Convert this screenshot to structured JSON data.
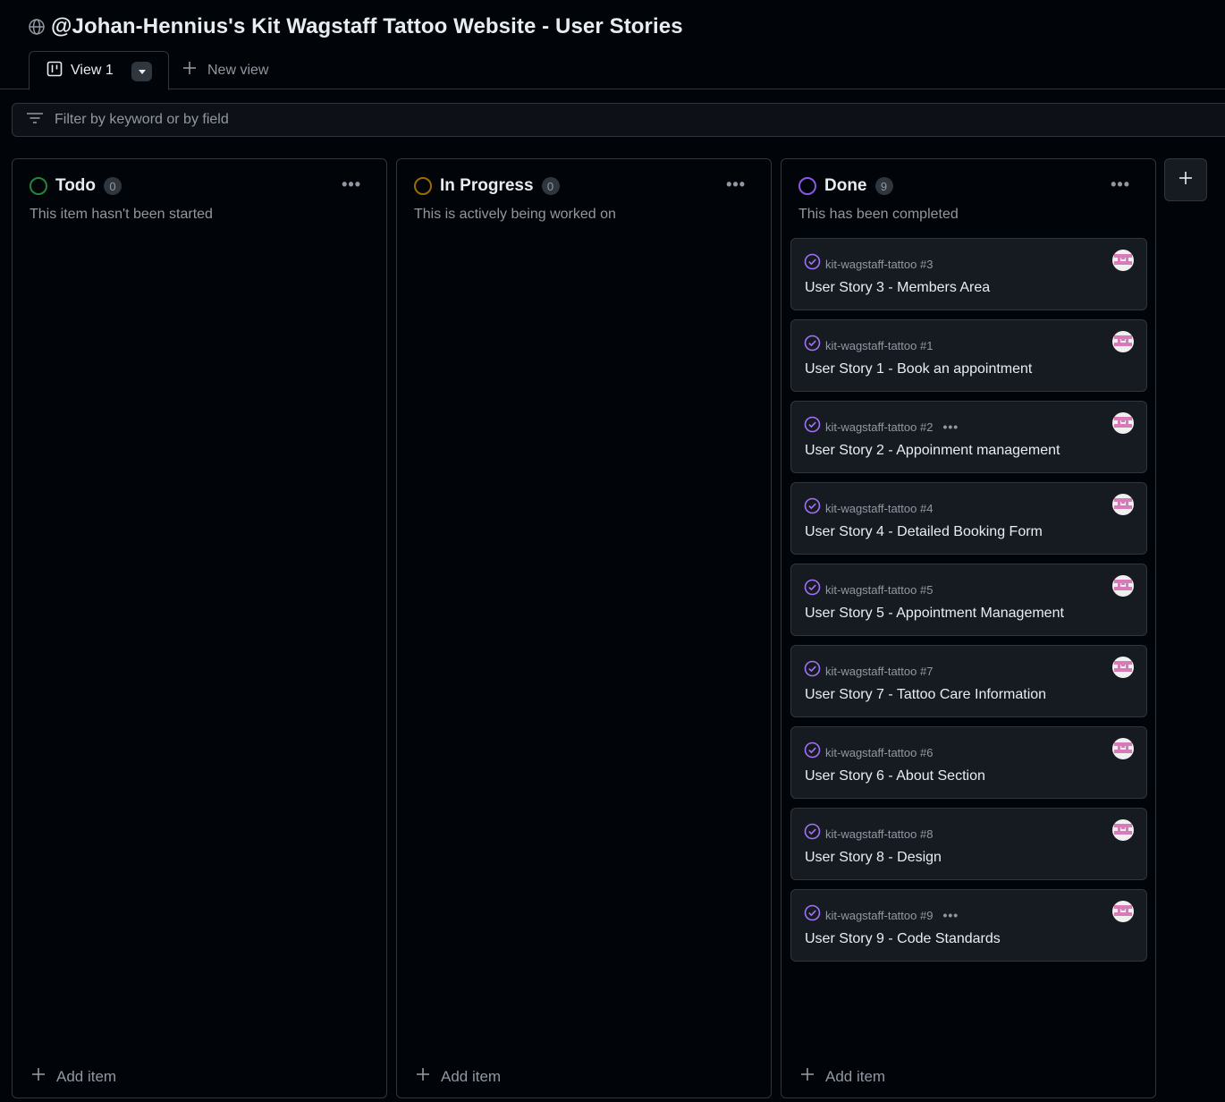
{
  "header": {
    "globe_icon": "globe-icon",
    "title": "@Johan-Hennius's Kit Wagstaff Tattoo Website - User Stories"
  },
  "tabs": {
    "active_label": "View 1",
    "new_view_label": "New view"
  },
  "filter": {
    "placeholder": "Filter by keyword or by field"
  },
  "colors": {
    "todo": "#238636",
    "in_progress": "#9e6a03",
    "done": "#8957e5",
    "done_icon": "#a371f7"
  },
  "columns": [
    {
      "title": "Todo",
      "count": "0",
      "description": "This item hasn't been started",
      "add_label": "Add item"
    },
    {
      "title": "In Progress",
      "count": "0",
      "description": "This is actively being worked on",
      "add_label": "Add item"
    },
    {
      "title": "Done",
      "count": "9",
      "description": "This has been completed",
      "add_label": "Add item"
    }
  ],
  "done_cards": [
    {
      "repo": "kit-wagstaff-tattoo #3",
      "title": "User Story 3 - Members Area",
      "more": ""
    },
    {
      "repo": "kit-wagstaff-tattoo #1",
      "title": "User Story 1 - Book an appointment",
      "more": ""
    },
    {
      "repo": "kit-wagstaff-tattoo #2",
      "title": "User Story 2 - Appoinment management",
      "more": "•••"
    },
    {
      "repo": "kit-wagstaff-tattoo #4",
      "title": "User Story 4 - Detailed Booking Form",
      "more": ""
    },
    {
      "repo": "kit-wagstaff-tattoo #5",
      "title": "User Story 5 - Appointment Management",
      "more": ""
    },
    {
      "repo": "kit-wagstaff-tattoo #7",
      "title": "User Story 7 - Tattoo Care Information",
      "more": ""
    },
    {
      "repo": "kit-wagstaff-tattoo #6",
      "title": "User Story 6 - About Section",
      "more": ""
    },
    {
      "repo": "kit-wagstaff-tattoo #8",
      "title": "User Story 8 - Design",
      "more": ""
    },
    {
      "repo": "kit-wagstaff-tattoo #9",
      "title": "User Story 9 - Code Standards",
      "more": "•••"
    }
  ]
}
